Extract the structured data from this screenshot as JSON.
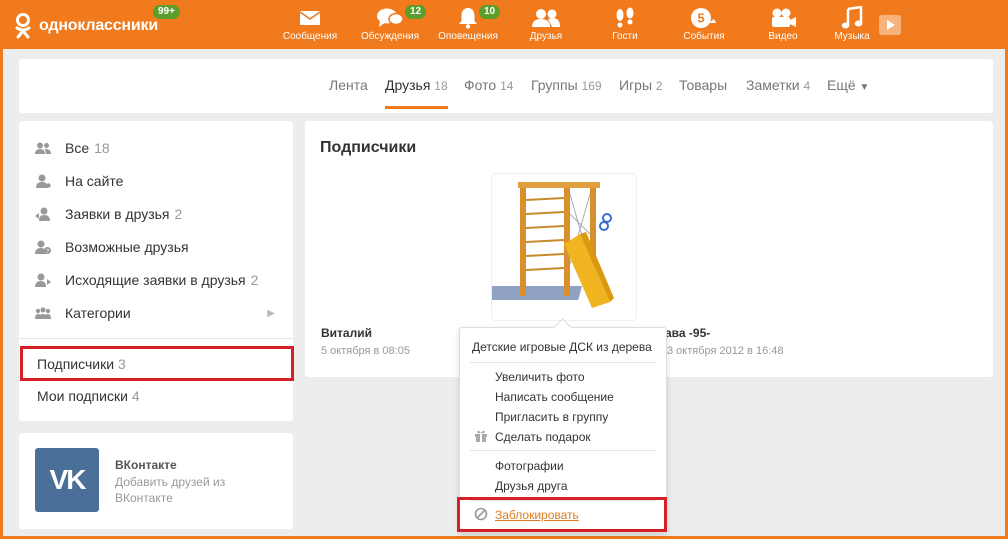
{
  "header": {
    "logo_text": "одноклассники",
    "logo_badge": "99+",
    "nav": [
      {
        "label": "Сообщения",
        "icon": "envelope-icon",
        "badge": ""
      },
      {
        "label": "Обсуждения",
        "icon": "chat-bubbles-icon",
        "badge": "12"
      },
      {
        "label": "Оповещения",
        "icon": "bell-icon",
        "badge": "10"
      },
      {
        "label": "Друзья",
        "icon": "friends-icon",
        "badge": ""
      },
      {
        "label": "Гости",
        "icon": "footprints-icon",
        "badge": ""
      },
      {
        "label": "События",
        "icon": "events-icon",
        "badge": ""
      },
      {
        "label": "Видео",
        "icon": "video-camera-icon",
        "badge": ""
      },
      {
        "label": "Музыка",
        "icon": "music-note-icon",
        "badge": ""
      }
    ]
  },
  "tabs": [
    {
      "label": "Лента",
      "count": ""
    },
    {
      "label": "Друзья",
      "count": "18"
    },
    {
      "label": "Фото",
      "count": "14"
    },
    {
      "label": "Группы",
      "count": "169"
    },
    {
      "label": "Игры",
      "count": "2"
    },
    {
      "label": "Товары",
      "count": ""
    },
    {
      "label": "Заметки",
      "count": "4"
    },
    {
      "label": "Ещё",
      "count": ""
    }
  ],
  "sidebar": {
    "items": [
      {
        "label": "Все",
        "count": "18",
        "icon": "people-icon"
      },
      {
        "label": "На сайте",
        "count": "",
        "icon": "person-online-icon"
      },
      {
        "label": "Заявки в друзья",
        "count": "2",
        "icon": "person-incoming-icon"
      },
      {
        "label": "Возможные друзья",
        "count": "",
        "icon": "person-question-icon"
      },
      {
        "label": "Исходящие заявки в друзья",
        "count": "2",
        "icon": "person-outgoing-icon"
      },
      {
        "label": "Категории",
        "count": "",
        "icon": "categories-icon"
      }
    ],
    "subscribers": {
      "label": "Подписчики",
      "count": "3"
    },
    "my_subscriptions": {
      "label": "Мои подписки",
      "count": "4"
    }
  },
  "vk": {
    "logo": "VK",
    "title": "ВКонтакте",
    "desc": "Добавить друзей из ВКонтакте"
  },
  "main": {
    "title": "Подписчики",
    "friends": [
      {
        "name": "Виталий",
        "date": "5 октября в 08:05"
      },
      {
        "name": "…ава -95-",
        "date": "3 октября 2012 в 16:48"
      }
    ]
  },
  "popup": {
    "header": "Детские игровые ДСК из дерева",
    "group1": [
      "Увеличить фото",
      "Написать сообщение",
      "Пригласить в группу",
      "Сделать подарок"
    ],
    "group2": [
      "Фотографии",
      "Друзья друга"
    ],
    "block": "Заблокировать"
  },
  "colors": {
    "brand": "#f07a1c",
    "badge": "#5b9e2c",
    "highlight": "#d61f26",
    "vk": "#4a6f99"
  }
}
